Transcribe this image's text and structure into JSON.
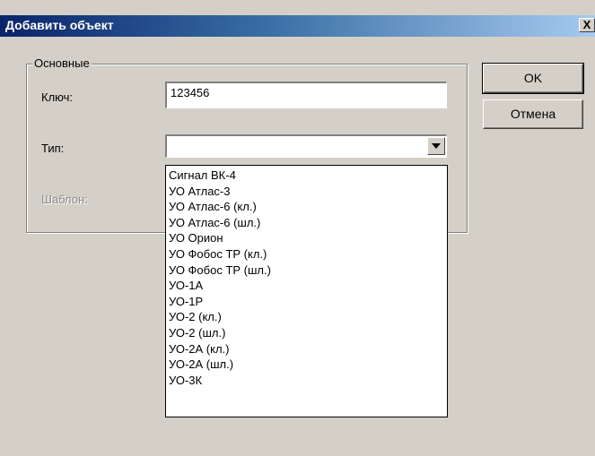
{
  "window": {
    "title": "Добавить объект",
    "close_glyph": "X"
  },
  "group": {
    "legend": "Основные"
  },
  "fields": {
    "key_label": "Ключ:",
    "key_value": "123456",
    "type_label": "Тип:",
    "type_value": "",
    "template_label": "Шаблон:"
  },
  "buttons": {
    "ok": "OK",
    "cancel": "Отмена"
  },
  "dropdown": {
    "options": [
      "Сигнал ВК-4",
      "УО Атлас-3",
      "УО Атлас-6 (кл.)",
      "УО Атлас-6 (шл.)",
      "УО Орион",
      "УО Фобос ТР (кл.)",
      "УО Фобос ТР (шл.)",
      "УО-1А",
      "УО-1Р",
      "УО-2 (кл.)",
      "УО-2 (шл.)",
      "УО-2А (кл.)",
      "УО-2А (шл.)",
      "УО-3К"
    ]
  }
}
